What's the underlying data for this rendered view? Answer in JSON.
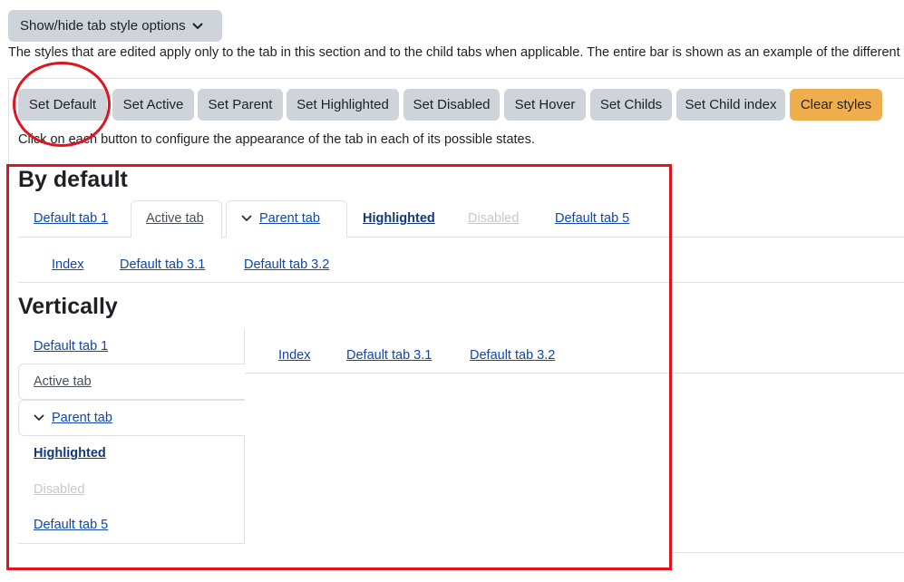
{
  "toggle": {
    "label": "Show/hide tab style options"
  },
  "intro": "The styles that are edited apply only to the tab in this section and to the child tabs when applicable. The entire bar is shown as an example of the different",
  "style_buttons": [
    "Set Default",
    "Set Active",
    "Set Parent",
    "Set Highlighted",
    "Set Disabled",
    "Set Hover",
    "Set Childs",
    "Set Child index",
    "Clear styles"
  ],
  "help": "Click on each button to configure the appearance of the tab in each of its possible states.",
  "default_section": {
    "heading": "By default",
    "tabs": [
      "Default tab 1",
      "Active tab",
      "Parent tab",
      "Highlighted",
      "Disabled",
      "Default tab 5"
    ],
    "child_tabs": [
      "Index",
      "Default tab 3.1",
      "Default tab 3.2"
    ]
  },
  "vertical_section": {
    "heading": "Vertically",
    "tabs": [
      "Default tab 1",
      "Active tab",
      "Parent tab",
      "Highlighted",
      "Disabled",
      "Default tab 5"
    ],
    "child_tabs": [
      "Index",
      "Default tab 3.1",
      "Default tab 3.2"
    ]
  },
  "colors": {
    "link": "#0f47ad",
    "button": "#ced4da",
    "clear_button": "#f0ad4e",
    "annotation": "#e0141e"
  }
}
